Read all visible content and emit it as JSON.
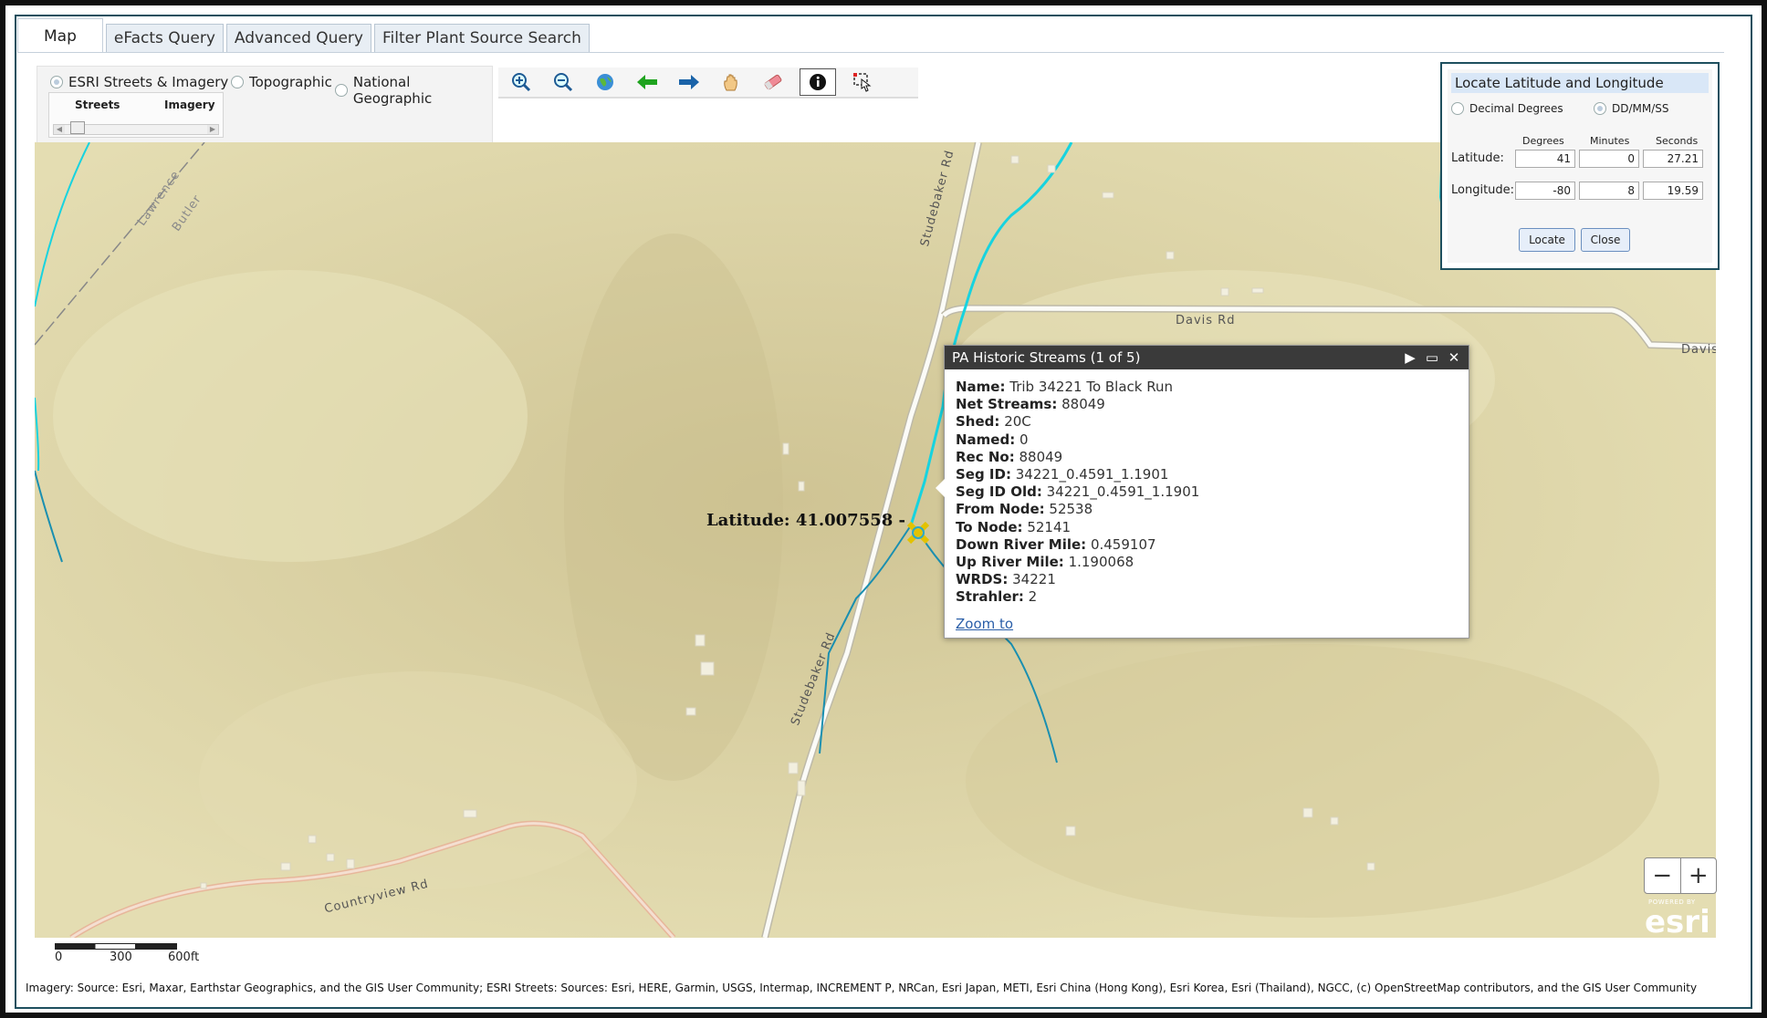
{
  "tabs": [
    {
      "label": "Map"
    },
    {
      "label": "eFacts Query"
    },
    {
      "label": "Advanced Query"
    },
    {
      "label": "Filter Plant Source Search"
    }
  ],
  "basemap": {
    "options": [
      "ESRI Streets & Imagery",
      "Topographic",
      "National Geographic"
    ],
    "selected": "ESRI Streets & Imagery",
    "slider_left": "Streets",
    "slider_right": "Imagery"
  },
  "toolbar": {
    "tools": [
      "zoom-in",
      "zoom-out",
      "full-extent",
      "previous-extent",
      "next-extent",
      "pan",
      "erase",
      "identify",
      "select"
    ]
  },
  "map": {
    "roads": [
      "Studebaker Rd",
      "Studebaker Rd",
      "Davis Rd",
      "Davis",
      "Countryview Rd",
      "Lawrence",
      "Butler"
    ],
    "coord_label": "Latitude: 41.007558 - Lon"
  },
  "popup": {
    "title": "PA Historic Streams (1 of 5)",
    "fields": [
      {
        "key": "Name:",
        "value": "Trib 34221 To Black Run"
      },
      {
        "key": "Net Streams:",
        "value": "88049"
      },
      {
        "key": "Shed:",
        "value": "20C"
      },
      {
        "key": "Named:",
        "value": "0"
      },
      {
        "key": "Rec No:",
        "value": "88049"
      },
      {
        "key": "Seg ID:",
        "value": "34221_0.4591_1.1901"
      },
      {
        "key": "Seg ID Old:",
        "value": "34221_0.4591_1.1901"
      },
      {
        "key": "From Node:",
        "value": "52538"
      },
      {
        "key": "To Node:",
        "value": "52141"
      },
      {
        "key": "Down River Mile:",
        "value": "0.459107"
      },
      {
        "key": "Up River Mile:",
        "value": "1.190068"
      },
      {
        "key": "WRDS:",
        "value": "34221"
      },
      {
        "key": "Strahler:",
        "value": "2"
      }
    ],
    "zoom_link": "Zoom to"
  },
  "locate": {
    "title": "Locate Latitude and Longitude",
    "option_decimal": "Decimal Degrees",
    "option_dms": "DD/MM/SS",
    "selected": "DD/MM/SS",
    "col_degrees": "Degrees",
    "col_minutes": "Minutes",
    "col_seconds": "Seconds",
    "lat_label": "Latitude:",
    "lon_label": "Longitude:",
    "lat": {
      "deg": "41",
      "min": "0",
      "sec": "27.21"
    },
    "lon": {
      "deg": "-80",
      "min": "8",
      "sec": "19.59"
    },
    "locate_btn": "Locate",
    "close_btn": "Close"
  },
  "zoom": {
    "minus": "−",
    "plus": "+"
  },
  "esri": {
    "powered": "POWERED BY",
    "brand": "esri"
  },
  "scale": {
    "labels": [
      "0",
      "300",
      "600ft"
    ]
  },
  "attribution": "Imagery: Source: Esri, Maxar, Earthstar Geographics, and the GIS User Community; ESRI Streets: Sources: Esri, HERE, Garmin, USGS, Intermap, INCREMENT P, NRCan, Esri Japan, METI, Esri China (Hong Kong), Esri Korea, Esri (Thailand), NGCC, (c) OpenStreetMap contributors, and the GIS User Community"
}
